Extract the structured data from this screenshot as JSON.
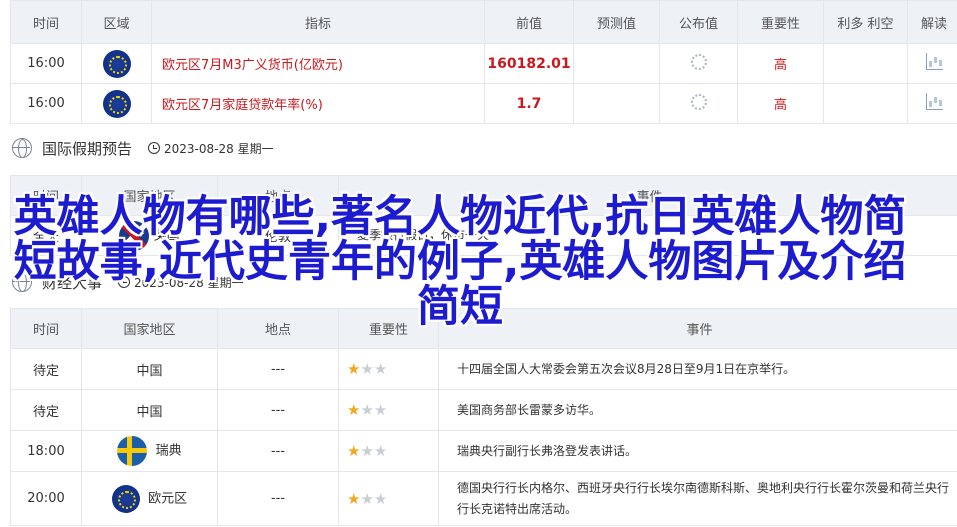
{
  "data_table": {
    "headers": [
      "时间",
      "区域",
      "指标",
      "前值",
      "预测值",
      "公布值",
      "重要性",
      "利多 利空",
      "解读"
    ],
    "rows": [
      {
        "time": "16:00",
        "region_icon": "eu-flag-icon",
        "name": "欧元区7月M3广义货币(亿欧元)",
        "prev": "160182.01",
        "importance": "高"
      },
      {
        "time": "16:00",
        "region_icon": "eu-flag-icon",
        "name": "欧元区7月家庭贷款年率(%)",
        "prev": "1.7",
        "importance": "高"
      }
    ]
  },
  "holiday_section": {
    "title": "国际假期预告",
    "date": "2023-08-28 星期一",
    "headers": [
      "时间",
      "国家地区",
      "地点",
      "事件"
    ],
    "rows": [
      {
        "time": "全天",
        "country": "英国",
        "place": "伦敦",
        "event": "夏季银行假日，休市一天"
      }
    ]
  },
  "events_section": {
    "title": "财经大事",
    "date": "2023-08-28 星期一",
    "headers": [
      "时间",
      "国家地区",
      "地点",
      "重要性",
      "事件"
    ],
    "rows": [
      {
        "time": "待定",
        "country": "中国",
        "place": "---",
        "stars": 1,
        "event": "十四届全国人大常委会第五次会议8月28日至9月1日在京举行。"
      },
      {
        "time": "待定",
        "country": "中国",
        "place": "---",
        "stars": 1,
        "event": "美国商务部长雷蒙多访华。"
      },
      {
        "time": "18:00",
        "country": "瑞典",
        "place": "---",
        "stars": 1,
        "event": "瑞典央行副行长弗洛登发表讲话。"
      },
      {
        "time": "20:00",
        "country": "欧元区",
        "place": "---",
        "stars": 1,
        "event": "德国央行行长内格尔、西班牙央行行长埃尔南德斯科斯、奥地利央行行长霍尔茨曼和荷兰央行行长克诺特出席活动。"
      }
    ]
  },
  "overlay_title": "英雄人物有哪些,著名人物近代,抗日英雄人物简短故事,近代史青年的例子,英雄人物图片及介绍简短",
  "colors": {
    "accent_red": "#c8191e",
    "overlay_blue": "#1c1bd0",
    "header_bg": "#eef1f6",
    "star": "#f0a91e"
  }
}
